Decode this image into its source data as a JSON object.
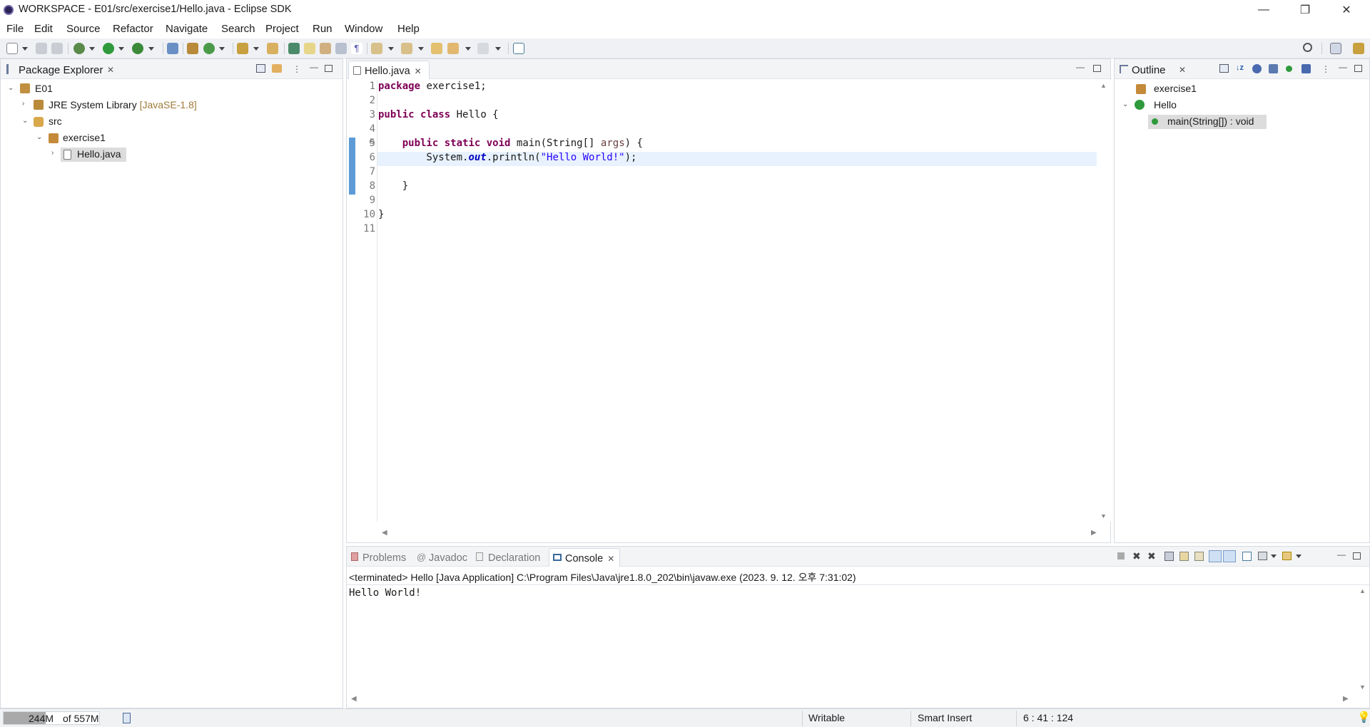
{
  "window": {
    "title": "WORKSPACE - E01/src/exercise1/Hello.java - Eclipse SDK",
    "controls": [
      "—",
      "❐",
      "✕"
    ]
  },
  "menubar": {
    "items": [
      {
        "label": "File"
      },
      {
        "label": "Edit"
      },
      {
        "label": "Source"
      },
      {
        "label": "Refactor"
      },
      {
        "label": "Navigate"
      },
      {
        "label": "Search"
      },
      {
        "label": "Project"
      },
      {
        "label": "Run"
      },
      {
        "label": "Window"
      },
      {
        "label": "Help"
      }
    ]
  },
  "package_explorer": {
    "tab_label": "Package Explorer",
    "tree": {
      "project": "E01",
      "jre": "JRE System Library",
      "jre_version": "[JavaSE-1.8]",
      "src": "src",
      "package": "exercise1",
      "file": "Hello.java"
    }
  },
  "editor": {
    "tab_label": "Hello.java",
    "line_numbers": [
      "1",
      "2",
      "3",
      "4",
      "5",
      "6",
      "7",
      "8",
      "9",
      "10",
      "11"
    ],
    "highlighted_line": 6,
    "lines": {
      "l1_kw": "package",
      "l1_rest": " exercise1;",
      "l3_kw1": "public",
      "l3_kw2": "class",
      "l3_rest": " Hello {",
      "l5_indent": "    ",
      "l5_kw1": "public",
      "l5_kw2": "static",
      "l5_kw3": "void",
      "l5_rest1": " main(String[] ",
      "l5_param": "args",
      "l5_rest2": ") {",
      "l6_pre": "        System.",
      "l6_field": "out",
      "l6_mid": ".println(",
      "l6_str": "\"Hello World!\"",
      "l6_post": ");",
      "l8": "    }",
      "l10": "}"
    }
  },
  "outline": {
    "tab_label": "Outline",
    "items": {
      "package": "exercise1",
      "class": "Hello",
      "method": "main(String[]) : void"
    }
  },
  "bottom_panel": {
    "tabs": {
      "problems": "Problems",
      "javadoc": "Javadoc",
      "declaration": "Declaration",
      "console": "Console"
    },
    "console_header": "<terminated> Hello [Java Application] C:\\Program Files\\Java\\jre1.8.0_202\\bin\\javaw.exe  (2023. 9. 12. 오후 7:31:02)",
    "console_output": "Hello World!"
  },
  "statusbar": {
    "heap_used": "244M",
    "heap_total": "of 557M",
    "heap_fraction": 0.44,
    "writable": "Writable",
    "insert_mode": "Smart Insert",
    "position": "6 : 41 : 124"
  },
  "colors": {
    "keyword": "#7f0055",
    "string": "#2a00ff",
    "static_field": "#0000c0",
    "current_line": "#e8f2fe",
    "toolbar_bg": "#eff1f4"
  }
}
